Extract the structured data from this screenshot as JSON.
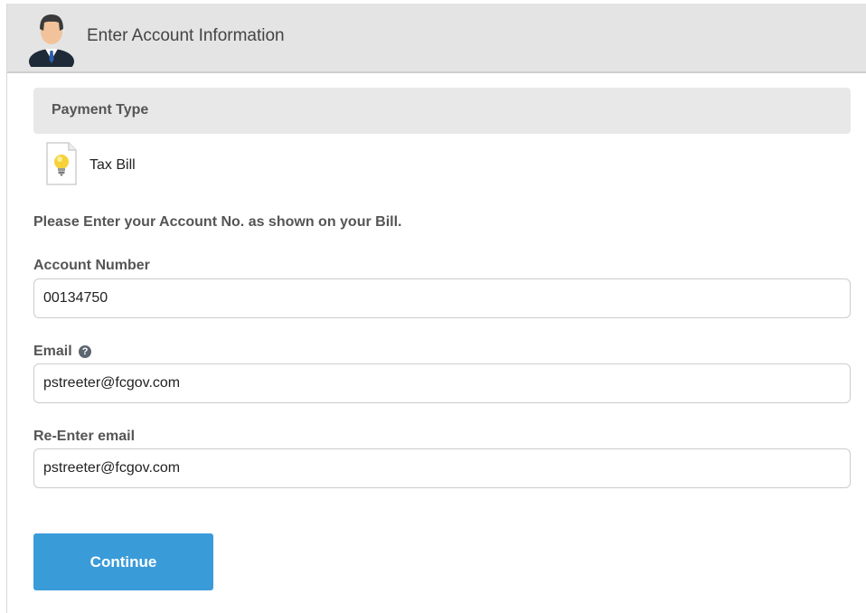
{
  "header": {
    "title": "Enter Account Information",
    "icon": "user-avatar-icon"
  },
  "payment_type": {
    "section_title": "Payment Type",
    "selected_type": "Tax Bill",
    "icon": "lightbulb-document-icon"
  },
  "instruction": "Please Enter your Account No. as shown on your Bill.",
  "fields": {
    "account_number": {
      "label": "Account Number",
      "value": "00134750"
    },
    "email": {
      "label": "Email",
      "value": "pstreeter@fcgov.com",
      "help_icon": "question-circle-icon"
    },
    "reenter_email": {
      "label": "Re-Enter email",
      "value": "pstreeter@fcgov.com"
    }
  },
  "actions": {
    "continue_label": "Continue"
  },
  "colors": {
    "header_bg": "#e4e4e4",
    "section_bg": "#e8e8e8",
    "button_bg": "#3a9bd9",
    "label_text": "#555555"
  }
}
